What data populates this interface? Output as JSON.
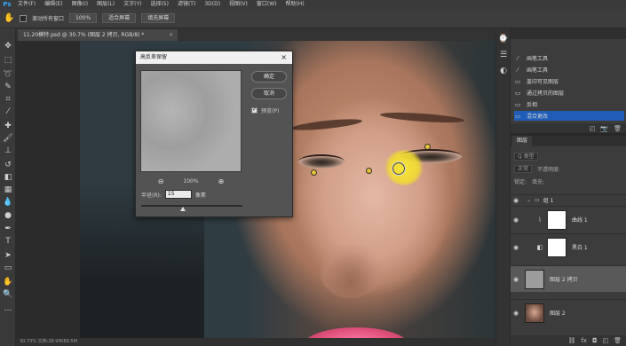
{
  "menu": {
    "logo": "Ps",
    "items": [
      "文件(F)",
      "编辑(E)",
      "图像(I)",
      "图层(L)",
      "文字(Y)",
      "选择(S)",
      "滤镜(T)",
      "3D(D)",
      "视图(V)",
      "窗口(W)",
      "帮助(H)"
    ]
  },
  "options": {
    "scroll_all_label": "滚动所有窗口",
    "zoom_value": "100%",
    "fit_screen": "适合屏幕",
    "fill_screen": "填充屏幕"
  },
  "document": {
    "tab_title": "11.20模特.psd @ 30.7% (图层 2 拷贝, RGB/8) *",
    "close": "×",
    "status": "30.73%   文档:28.9M/89.5M"
  },
  "dialog": {
    "title": "高反差保留",
    "close": "×",
    "ok": "确定",
    "cancel": "取消",
    "preview_label": "预览(P)",
    "preview_checked": true,
    "zoom_out_icon": "zoom-out-icon",
    "zoom_in_icon": "zoom-in-icon",
    "zoom_value": "100%",
    "radius_label": "半径(R):",
    "radius_value": "15",
    "radius_unit": "像素",
    "radius_slider_fraction": 0.41
  },
  "history": {
    "items": [
      {
        "label": "画笔工具",
        "icon": "brush-icon",
        "active": false
      },
      {
        "label": "画笔工具",
        "icon": "brush-icon",
        "active": false
      },
      {
        "label": "盖印可见图层",
        "icon": "layer-icon",
        "active": false
      },
      {
        "label": "通过拷贝的图层",
        "icon": "layer-icon",
        "active": false
      },
      {
        "label": "反相",
        "icon": "layer-icon",
        "active": false
      },
      {
        "label": "混合更改",
        "icon": "layer-icon",
        "active": true
      }
    ]
  },
  "layers": {
    "tab": "图层",
    "kind_filter": "Q 类型",
    "blend_mode": "正常",
    "opacity_label": "不透明度:",
    "fill_label": "填充:",
    "lock_label": "锁定:",
    "group": {
      "name": "组 1"
    },
    "rows": [
      {
        "name": "曲线 1",
        "adjustment_icon": "curves-icon",
        "has_mask": true,
        "selected": false,
        "thumb_color": "#ffffff"
      },
      {
        "name": "黑白 1",
        "adjustment_icon": "bw-icon",
        "has_mask": true,
        "selected": false,
        "thumb_color": "#ffffff"
      },
      {
        "name": "图层 2 拷贝",
        "adjustment_icon": "",
        "has_mask": false,
        "selected": true,
        "thumb_color": "#9c9c9c"
      },
      {
        "name": "图层 2",
        "adjustment_icon": "",
        "has_mask": false,
        "selected": false,
        "thumb_color": "#b98872"
      }
    ]
  },
  "colors": {
    "accent": "#1f5db8",
    "highlight": "#f5e132",
    "lips": "#e0527c"
  }
}
